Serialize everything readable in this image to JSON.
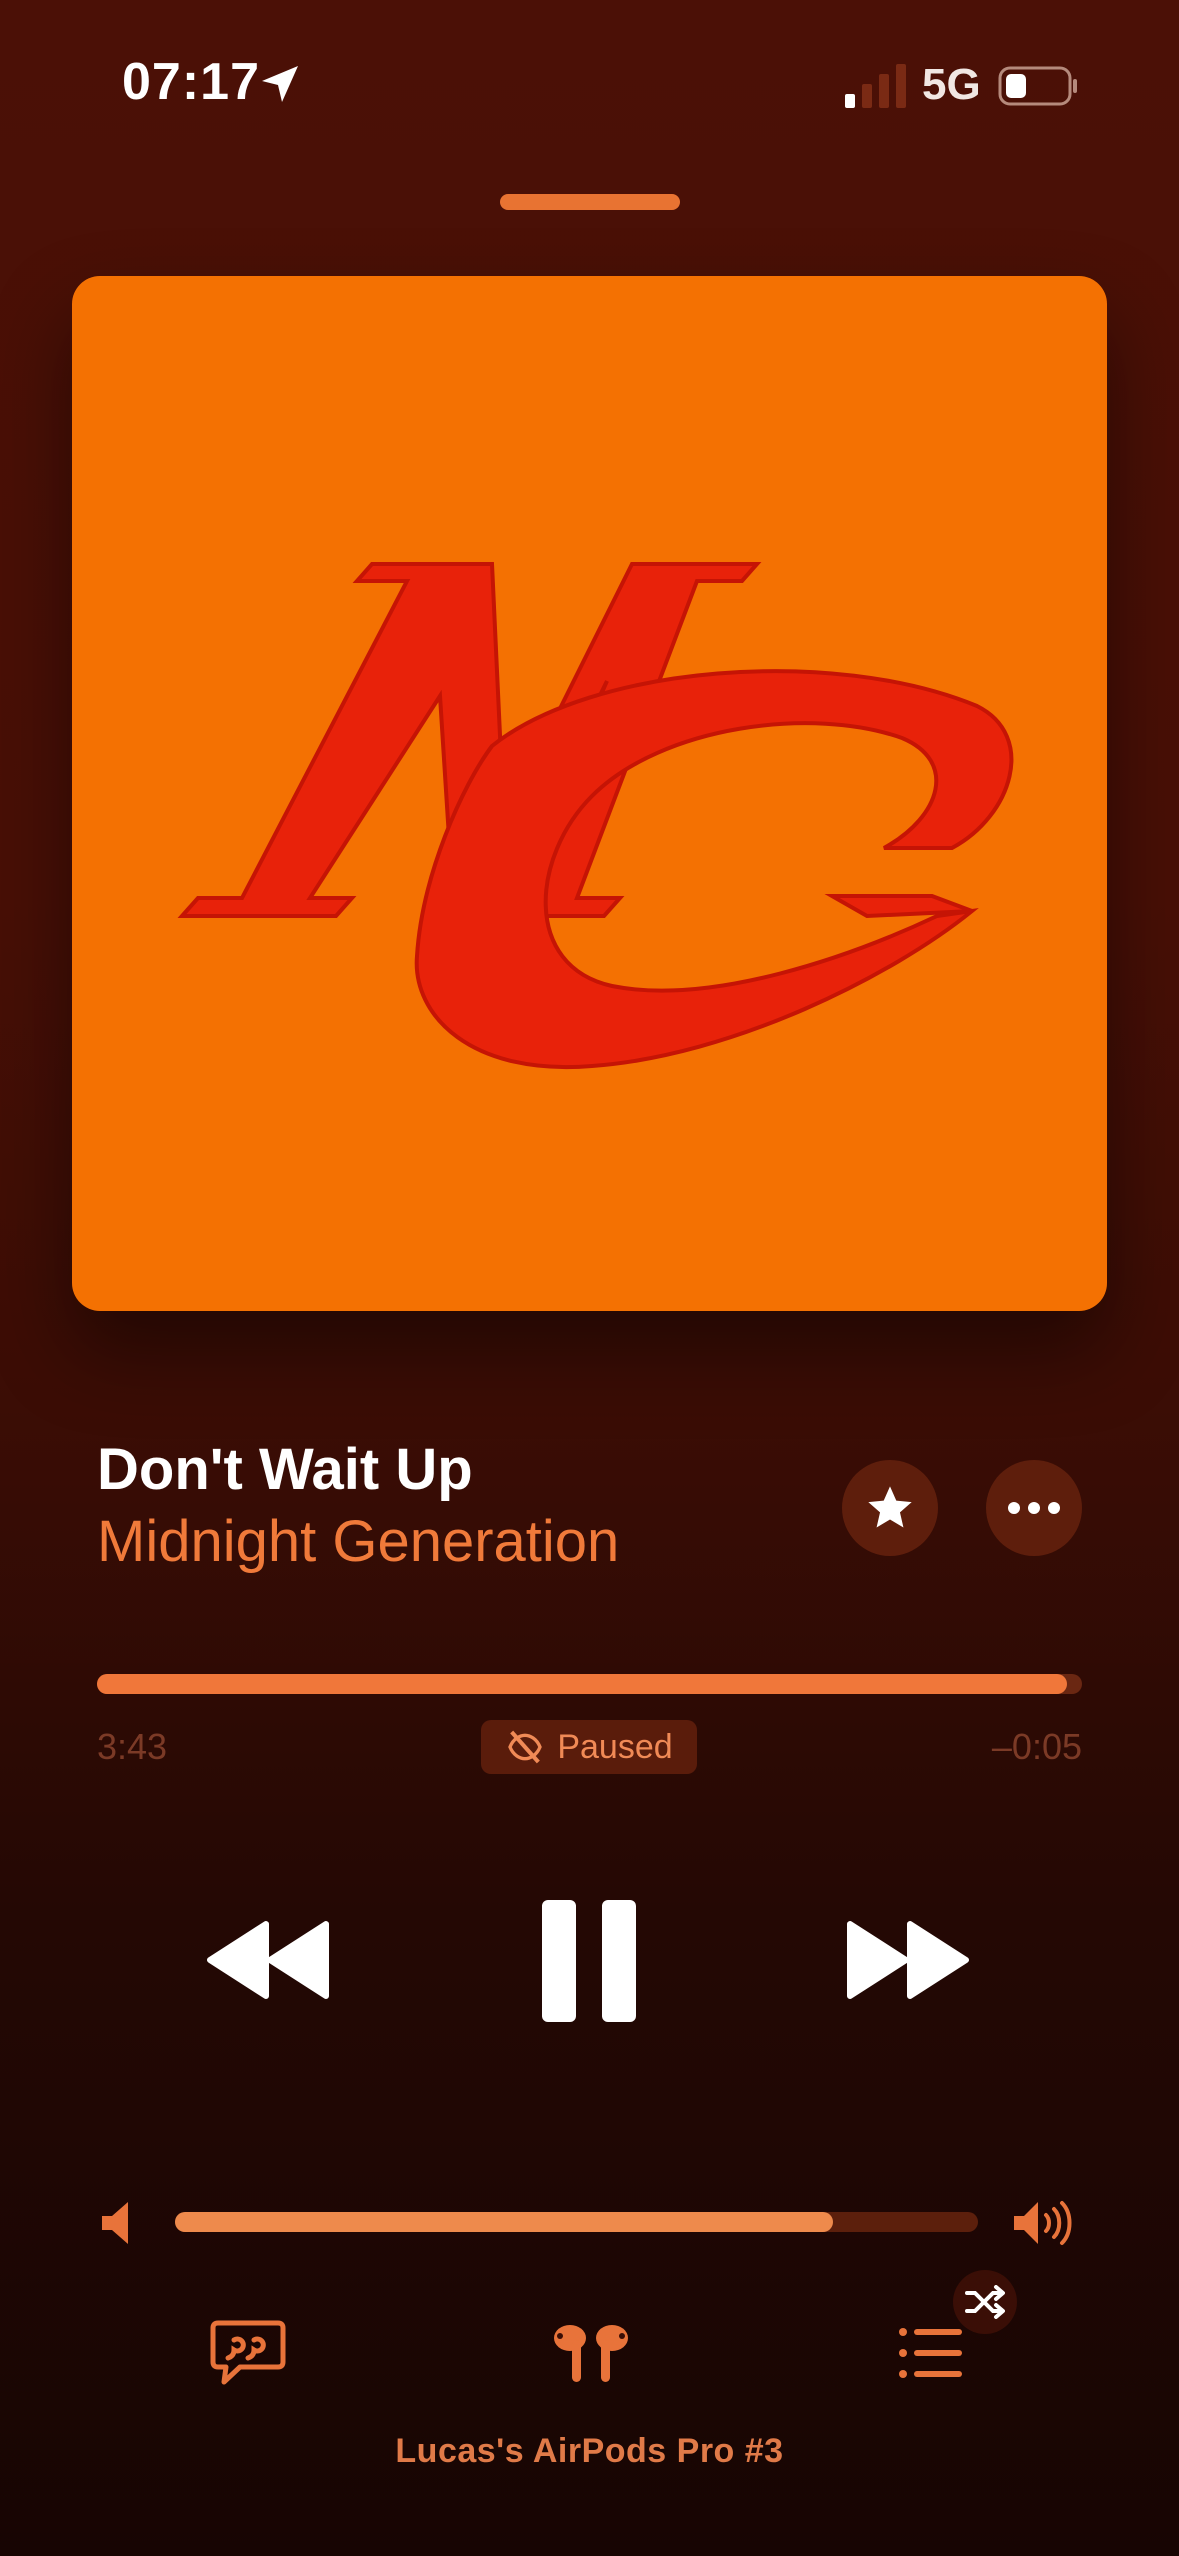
{
  "status_bar": {
    "time": "07:17",
    "location_icon": "location-arrow-icon",
    "signal_icon": "cellular-signal-icon",
    "network": "5G",
    "battery_icon": "battery-low-icon"
  },
  "player": {
    "track_title": "Don't Wait Up",
    "artist": "Midnight Generation",
    "artwork_monogram": "MG",
    "favorite_icon": "star-icon",
    "more_icon": "ellipsis-icon",
    "progress_fraction": 0.985,
    "elapsed": "3:43",
    "remaining": "–0:05",
    "status_label": "Paused",
    "status_icon": "paused-no-audio-icon",
    "volume_fraction": 0.82
  },
  "controls": {
    "rewind_icon": "rewind-icon",
    "pause_icon": "pause-icon",
    "forward_icon": "fast-forward-icon",
    "lyrics_icon": "lyrics-quote-icon",
    "output_icon": "airpods-icon",
    "queue_icon": "queue-list-icon",
    "shuffle_icon": "shuffle-icon"
  },
  "output_device": "Lucas's AirPods Pro #3",
  "colors": {
    "accent": "#f0773a",
    "artwork_bg": "#f47102",
    "artwork_logo": "#e8220a",
    "background_top": "#4b1006",
    "background_bottom": "#170503"
  }
}
